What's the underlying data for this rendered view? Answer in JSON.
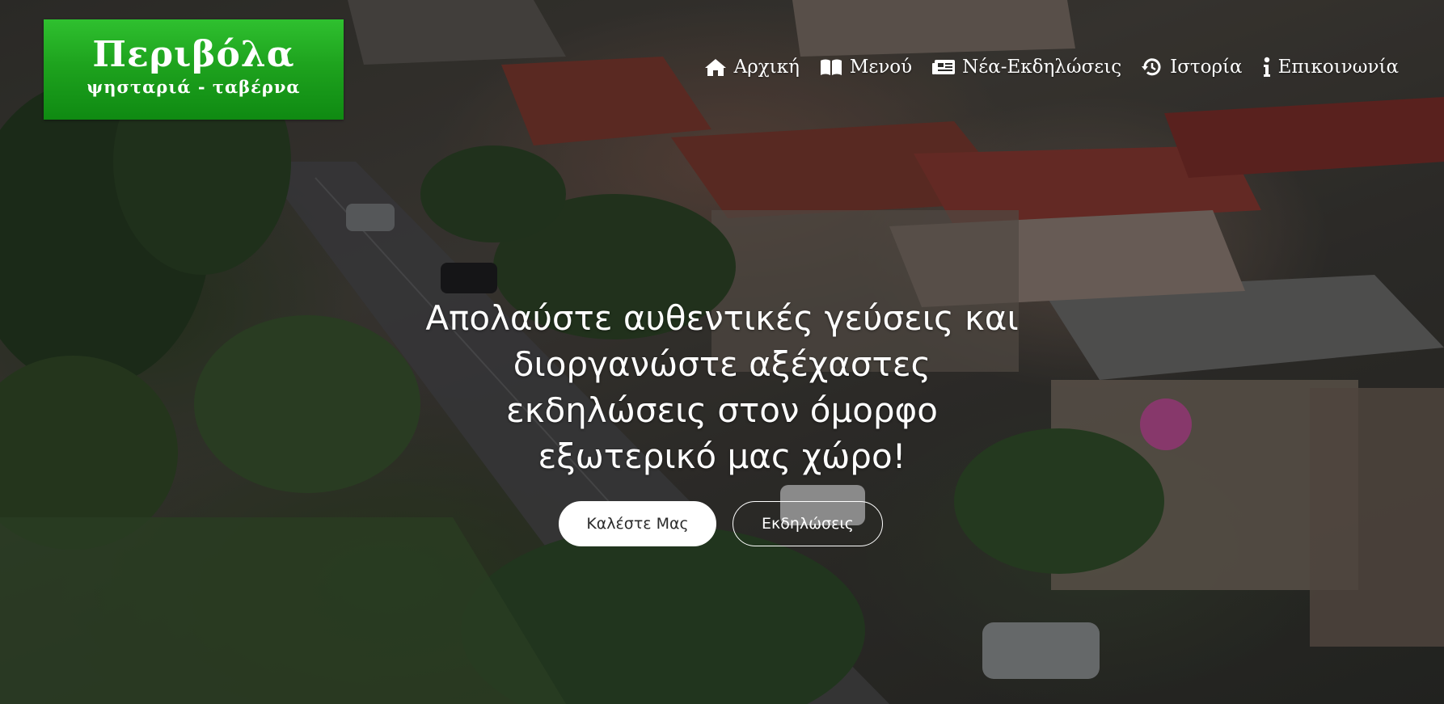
{
  "logo": {
    "title": "Περιβόλα",
    "subtitle": "ψησταριά - ταβέρνα"
  },
  "nav": {
    "items": [
      {
        "label": "Αρχική",
        "icon": "home-icon"
      },
      {
        "label": "Μενού",
        "icon": "book-icon"
      },
      {
        "label": "Νέα-Εκδηλώσεις",
        "icon": "newspaper-icon"
      },
      {
        "label": "Ιστορία",
        "icon": "history-icon"
      },
      {
        "label": "Επικοινωνία",
        "icon": "info-icon"
      }
    ]
  },
  "hero": {
    "headline_line1": "Απολαύστε αυθεντικές γεύσεις και",
    "headline_line2": "διοργανώστε αξέχαστες",
    "headline_line3": "εκδηλώσεις στον όμορφο",
    "headline_line4": "εξωτερικό μας χώρο!",
    "call_button": "Καλέστε Μας",
    "events_button": "Εκδηλώσεις"
  },
  "colors": {
    "logo_green": "#1ea31e",
    "text": "#ffffff"
  }
}
